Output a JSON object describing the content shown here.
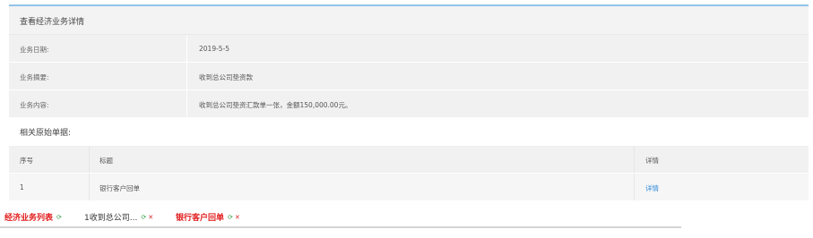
{
  "panel": {
    "title": "查看经济业务详情",
    "fields": [
      {
        "label": "业务日期:",
        "value": "2019-5-5"
      },
      {
        "label": "业务摘要:",
        "value": "收到总公司垫资款"
      },
      {
        "label": "业务内容:",
        "value": "收到总公司垫资汇款单一张，金额150,000.00元。"
      }
    ]
  },
  "attachments": {
    "heading": "相关原始单据:",
    "columns": {
      "no": "序号",
      "title": "标题",
      "detail": "详情"
    },
    "rows": [
      {
        "no": "1",
        "title": "银行客户回单",
        "detail": "详情"
      }
    ]
  },
  "tabs": [
    {
      "label": "经济业务列表",
      "style": "red",
      "closable": false
    },
    {
      "label": "1收到总公司...",
      "style": "dark",
      "closable": true
    },
    {
      "label": "银行客户回单",
      "style": "red",
      "closable": true
    }
  ],
  "colors": {
    "accent": "#8fc3ea",
    "link": "#2a88d8",
    "tab_red": "#e21d1d",
    "refresh_green": "#37a24a"
  }
}
